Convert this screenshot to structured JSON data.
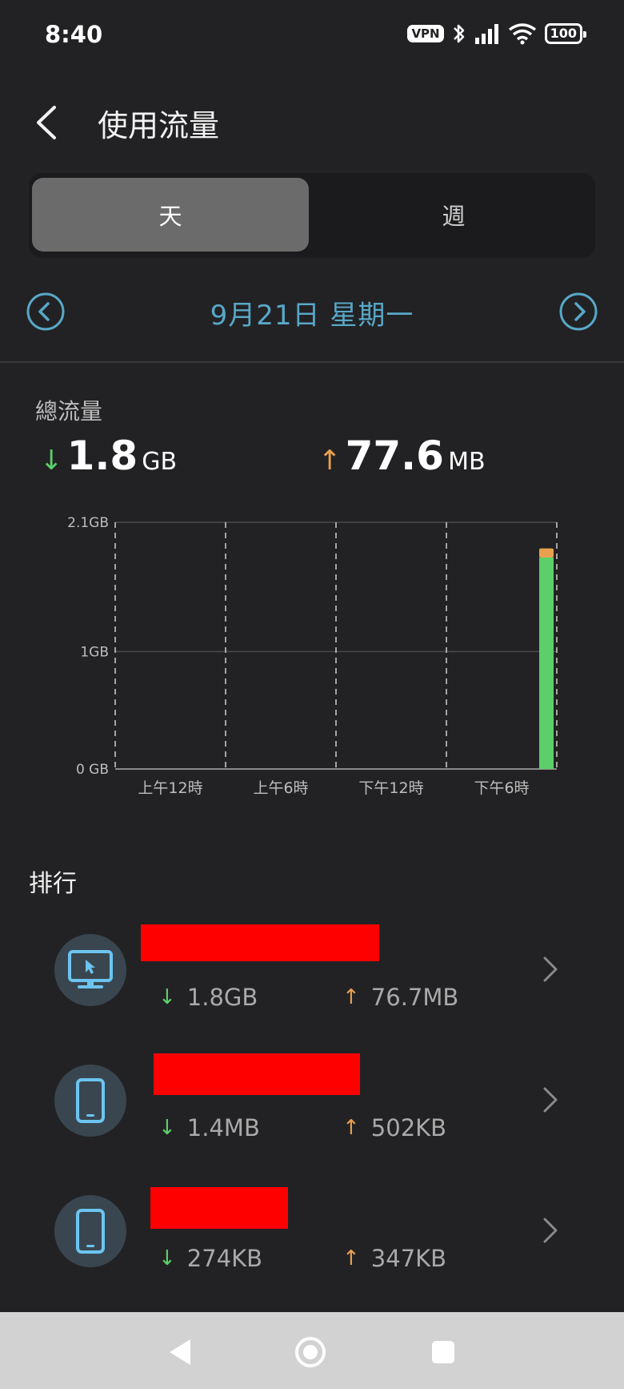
{
  "status_bar": {
    "time": "8:40",
    "vpn": "VPN",
    "battery": "100"
  },
  "header": {
    "title": "使用流量"
  },
  "segmented": {
    "day": "天",
    "week": "週"
  },
  "date_nav": {
    "date": "9月21日 星期一"
  },
  "totals": {
    "label": "總流量",
    "download_value": "1.8",
    "download_unit": "GB",
    "upload_value": "77.6",
    "upload_unit": "MB"
  },
  "chart_data": {
    "type": "bar",
    "categories": [
      "上午12時",
      "上午6時",
      "下午12時",
      "下午6時"
    ],
    "y_ticks": [
      "2.1GB",
      "1GB",
      "0 GB"
    ],
    "ylim": [
      0,
      2.1
    ],
    "grid": true,
    "series": [
      {
        "values": [
          0,
          0,
          0,
          1.8
        ],
        "color": "#5ccf6a"
      },
      {
        "values": [
          0,
          0,
          0,
          0.0776
        ],
        "color": "#e8a050"
      }
    ]
  },
  "ranking": {
    "title": "排行",
    "items": [
      {
        "icon": "monitor-icon",
        "download": "1.8GB",
        "upload": "76.7MB"
      },
      {
        "icon": "phone-icon",
        "download": "1.4MB",
        "upload": "502KB"
      },
      {
        "icon": "phone-icon",
        "download": "274KB",
        "upload": "347KB"
      }
    ]
  },
  "colors": {
    "download": "#5ccf6a",
    "upload": "#e8a050",
    "accent": "#58a8c8",
    "redaction": "#ff0000"
  }
}
